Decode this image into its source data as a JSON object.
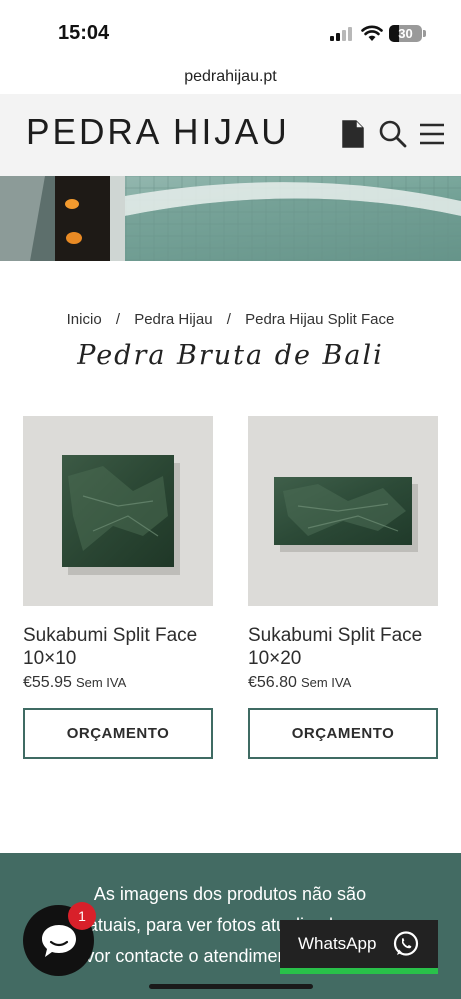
{
  "status_bar": {
    "time": "15:04",
    "battery": "30",
    "battery_level": 0.3
  },
  "browser": {
    "url": "pedrahijau.pt"
  },
  "header": {
    "logo": "PEDRA HIJAU",
    "icons": [
      "document-icon",
      "search-icon",
      "menu-icon"
    ]
  },
  "breadcrumb": {
    "items": [
      "Inicio",
      "Pedra Hijau",
      "Pedra Hijau Split Face"
    ],
    "separator": "/"
  },
  "page_title": "Pedra Bruta de Bali",
  "products": [
    {
      "name": "Sukabumi Split Face 10×10",
      "price": "€55.95",
      "tax": "Sem IVA",
      "button": "ORÇAMENTO"
    },
    {
      "name": "Sukabumi Split Face 10×20",
      "price": "€56.80",
      "tax": "Sem IVA",
      "button": "ORÇAMENTO"
    }
  ],
  "notice": {
    "text": "As imagens dos produtos não são gratuais, para ver fotos atualizadas, por favor contacte o atendimento ao cliente."
  },
  "chat": {
    "badge_count": "1"
  },
  "whatsapp": {
    "label": "WhatsApp"
  },
  "colors": {
    "accent": "#436b63",
    "button_border": "#3f6b63",
    "whatsapp_green": "#29c14a",
    "badge_red": "#d8202a"
  }
}
